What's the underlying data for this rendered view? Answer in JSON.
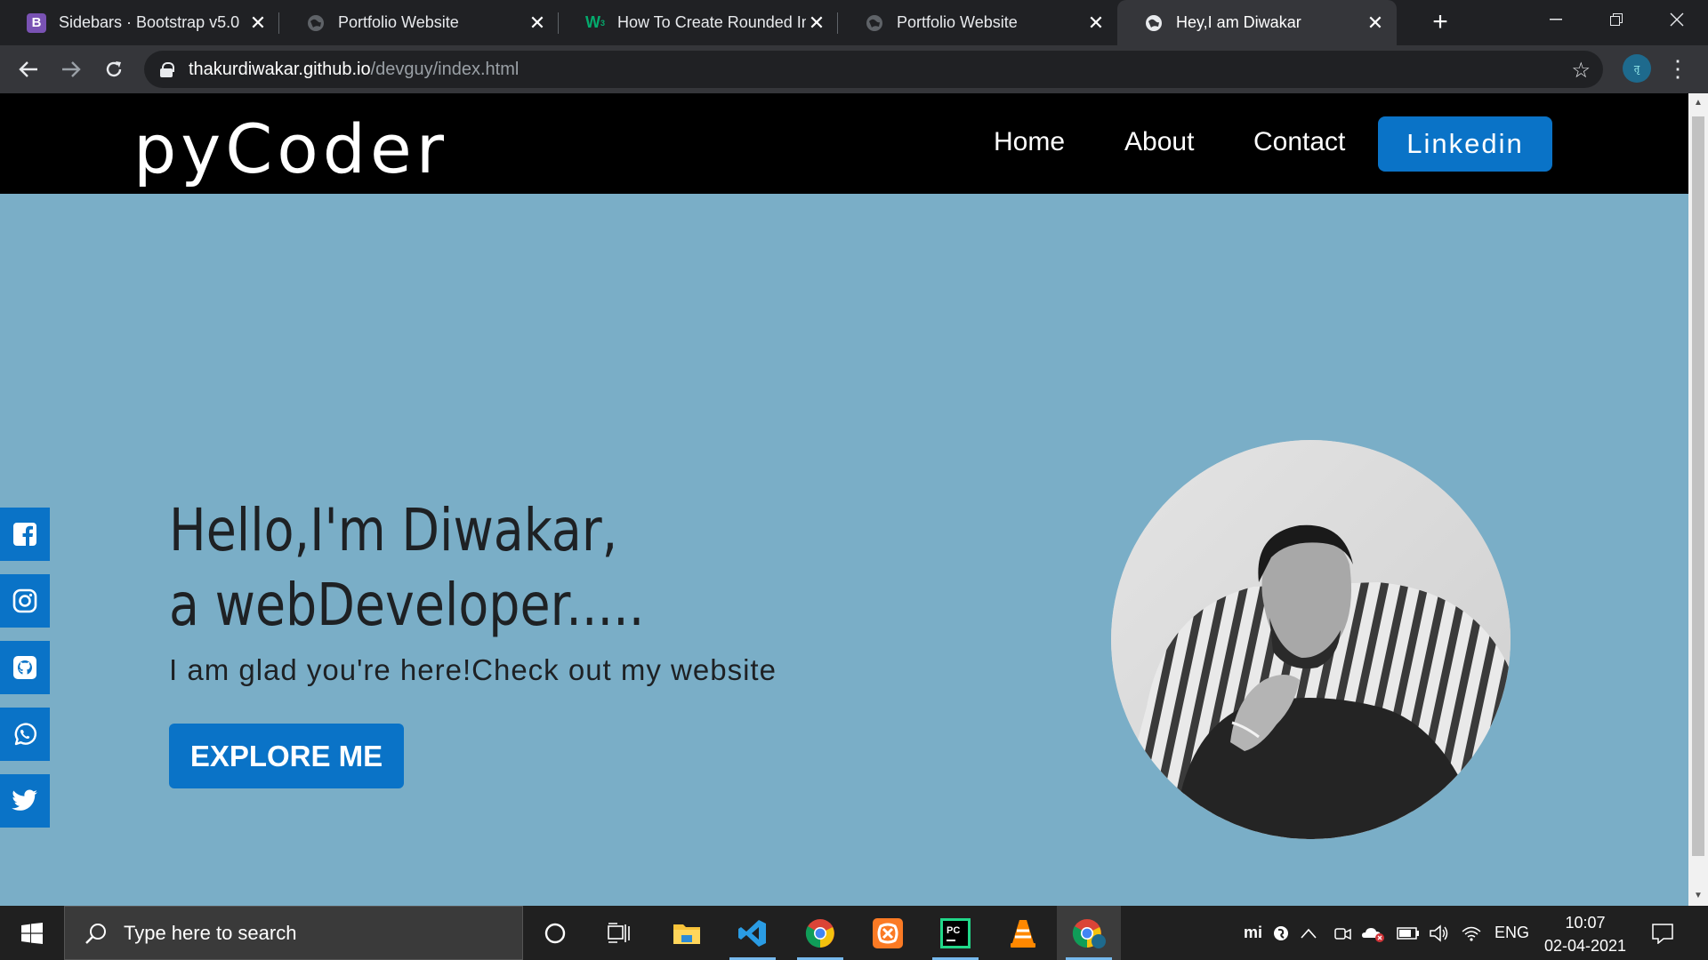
{
  "browser": {
    "tabs": [
      {
        "title": "Sidebars · Bootstrap v5.0",
        "favicon": "bootstrap-favicon",
        "active": false
      },
      {
        "title": "Portfolio Website",
        "favicon": "globe-favicon",
        "active": false
      },
      {
        "title": "How To Create Rounded Im",
        "favicon": "w3schools-favicon",
        "active": false
      },
      {
        "title": "Portfolio Website",
        "favicon": "globe-favicon",
        "active": false
      },
      {
        "title": "Hey,I am Diwakar",
        "favicon": "globe-favicon",
        "active": true
      }
    ],
    "url_host": "thakurdiwakar.github.io",
    "url_path": "/devguy/index.html",
    "profile_initials": "तृ"
  },
  "site": {
    "brand": "pyCoder",
    "nav": {
      "home": "Home",
      "about": "About",
      "contact": "Contact",
      "linkedin": "Linkedin"
    },
    "hero": {
      "line1": "Hello,I'm Diwakar,",
      "line2": "a webDeveloper.....",
      "tagline": "I am glad you're here!Check out my website",
      "cta": "EXPLORE ME"
    },
    "social": [
      "facebook-icon",
      "instagram-icon",
      "github-icon",
      "whatsapp-icon",
      "twitter-icon"
    ]
  },
  "taskbar": {
    "search_placeholder": "Type here to search",
    "pinned": [
      "cortana-icon",
      "task-view-icon",
      "file-explorer-icon",
      "vscode-icon",
      "chrome-icon",
      "xampp-icon",
      "pycharm-icon",
      "vlc-icon",
      "chrome-profile-icon"
    ],
    "language": "ENG",
    "time": "10:07",
    "date": "02-04-2021"
  },
  "colors": {
    "page_bg": "#7aaec7",
    "accent": "#0a73c7",
    "navbar": "#000000",
    "browser_frame": "#202124",
    "taskbar": "#202020"
  }
}
